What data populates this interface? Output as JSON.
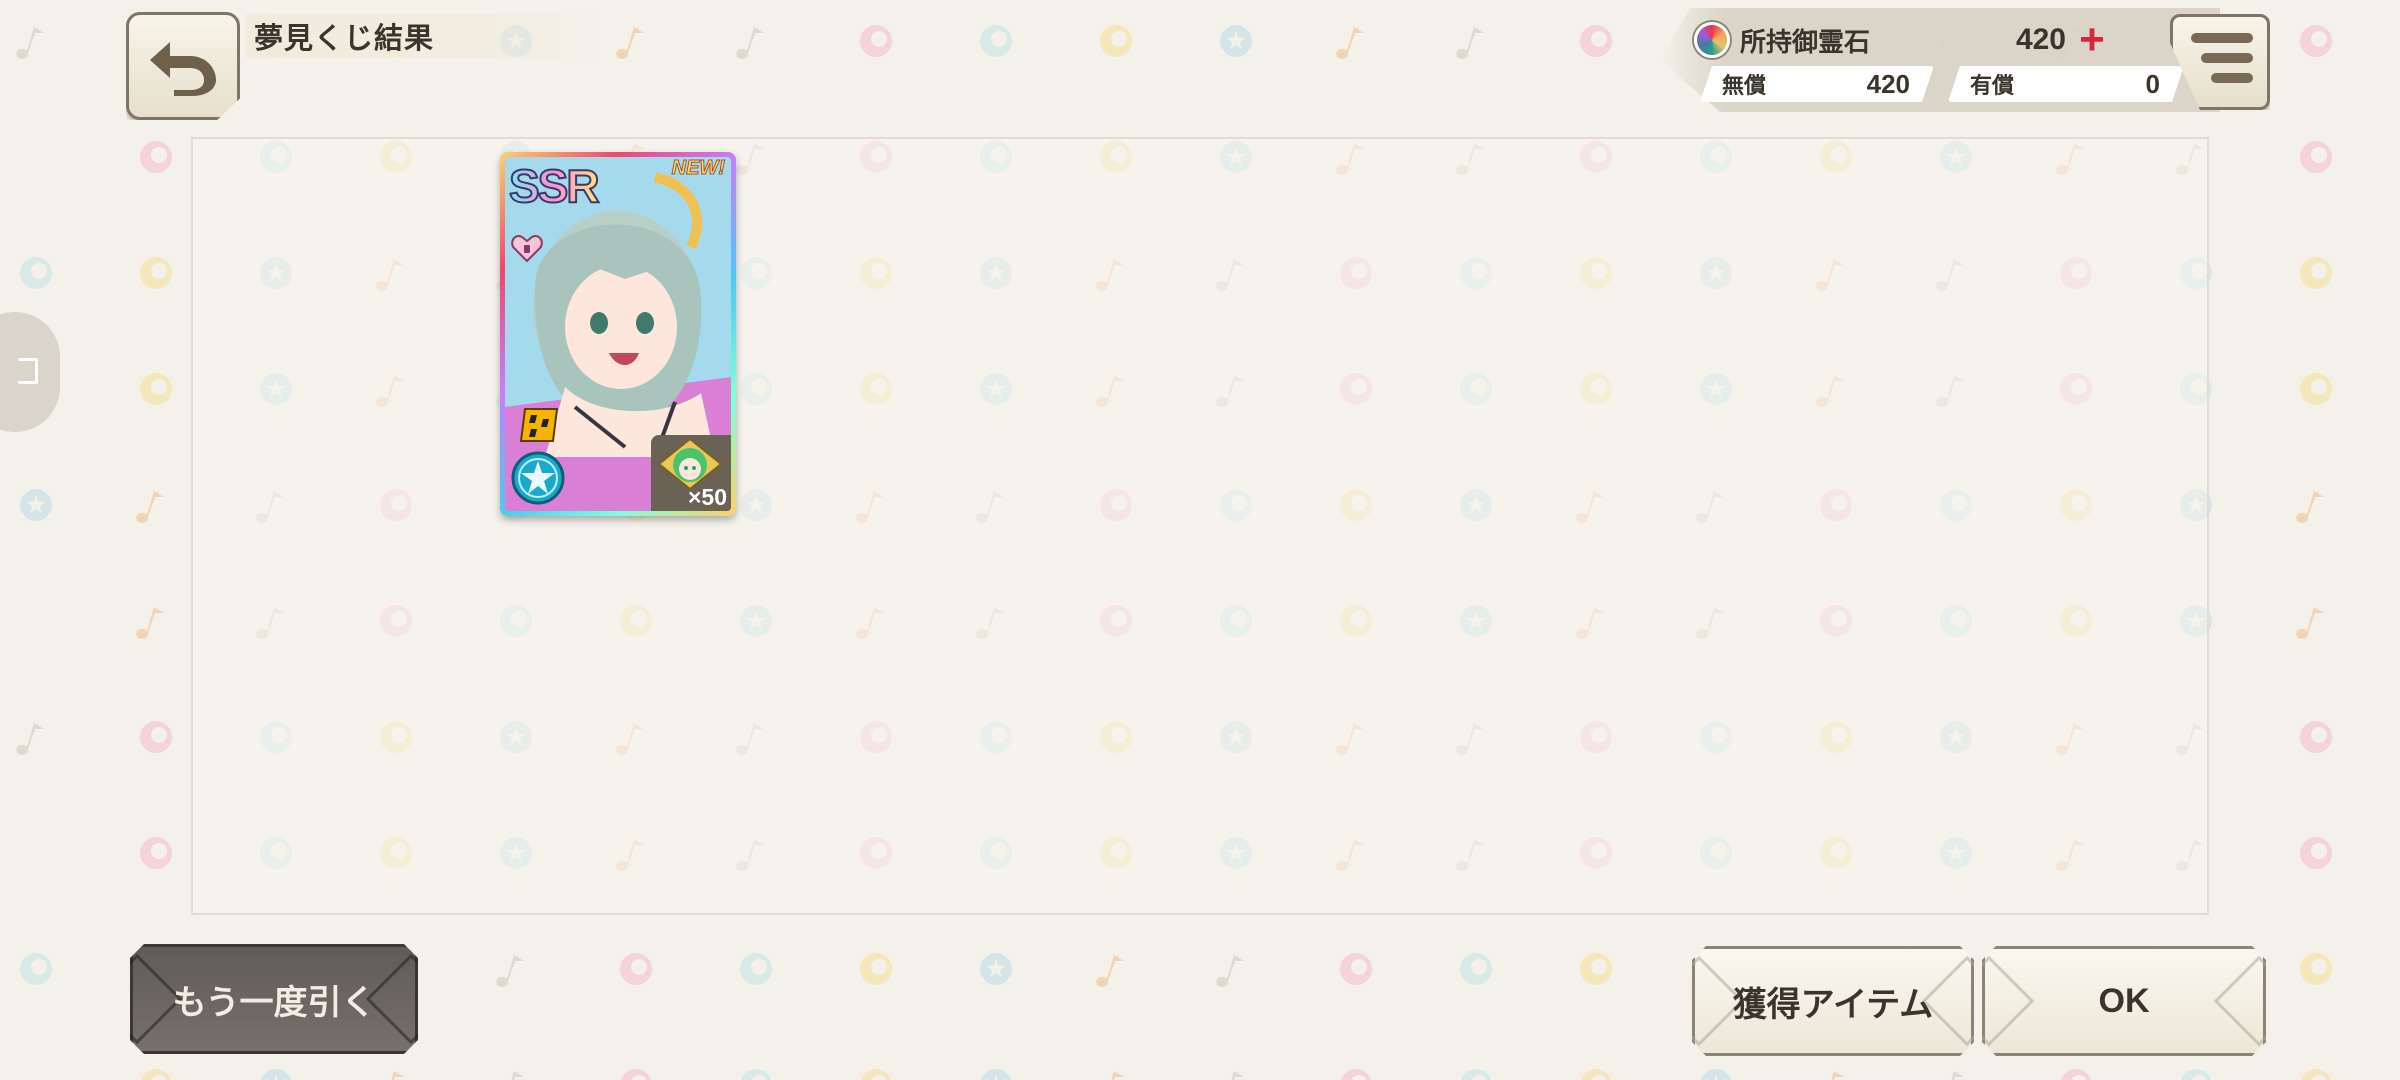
{
  "header": {
    "title": "夢見くじ結果",
    "back_icon": "back-arrow-icon",
    "menu_icon": "menu-icon"
  },
  "currency": {
    "label": "所持御霊石",
    "total": "420",
    "plus_icon": "plus-icon",
    "free_label": "無償",
    "free_value": "420",
    "paid_label": "有償",
    "paid_value": "0"
  },
  "result": {
    "cards": [
      {
        "rarity": "SSR",
        "new_label": "NEW!",
        "quantity": "×50",
        "attribute_icon": "star-attribute-icon",
        "heart_icon": "heart-lock-icon",
        "character_icon": "green-hair-chibi-icon"
      }
    ]
  },
  "buttons": {
    "draw_again": "もう一度引く",
    "obtained_items": "獲得アイテム",
    "ok": "OK"
  },
  "colors": {
    "background": "#f3f1ea",
    "dark_button": "#5f5b55",
    "light_button": "#f9f7ef",
    "accent_plus": "#d62839"
  }
}
